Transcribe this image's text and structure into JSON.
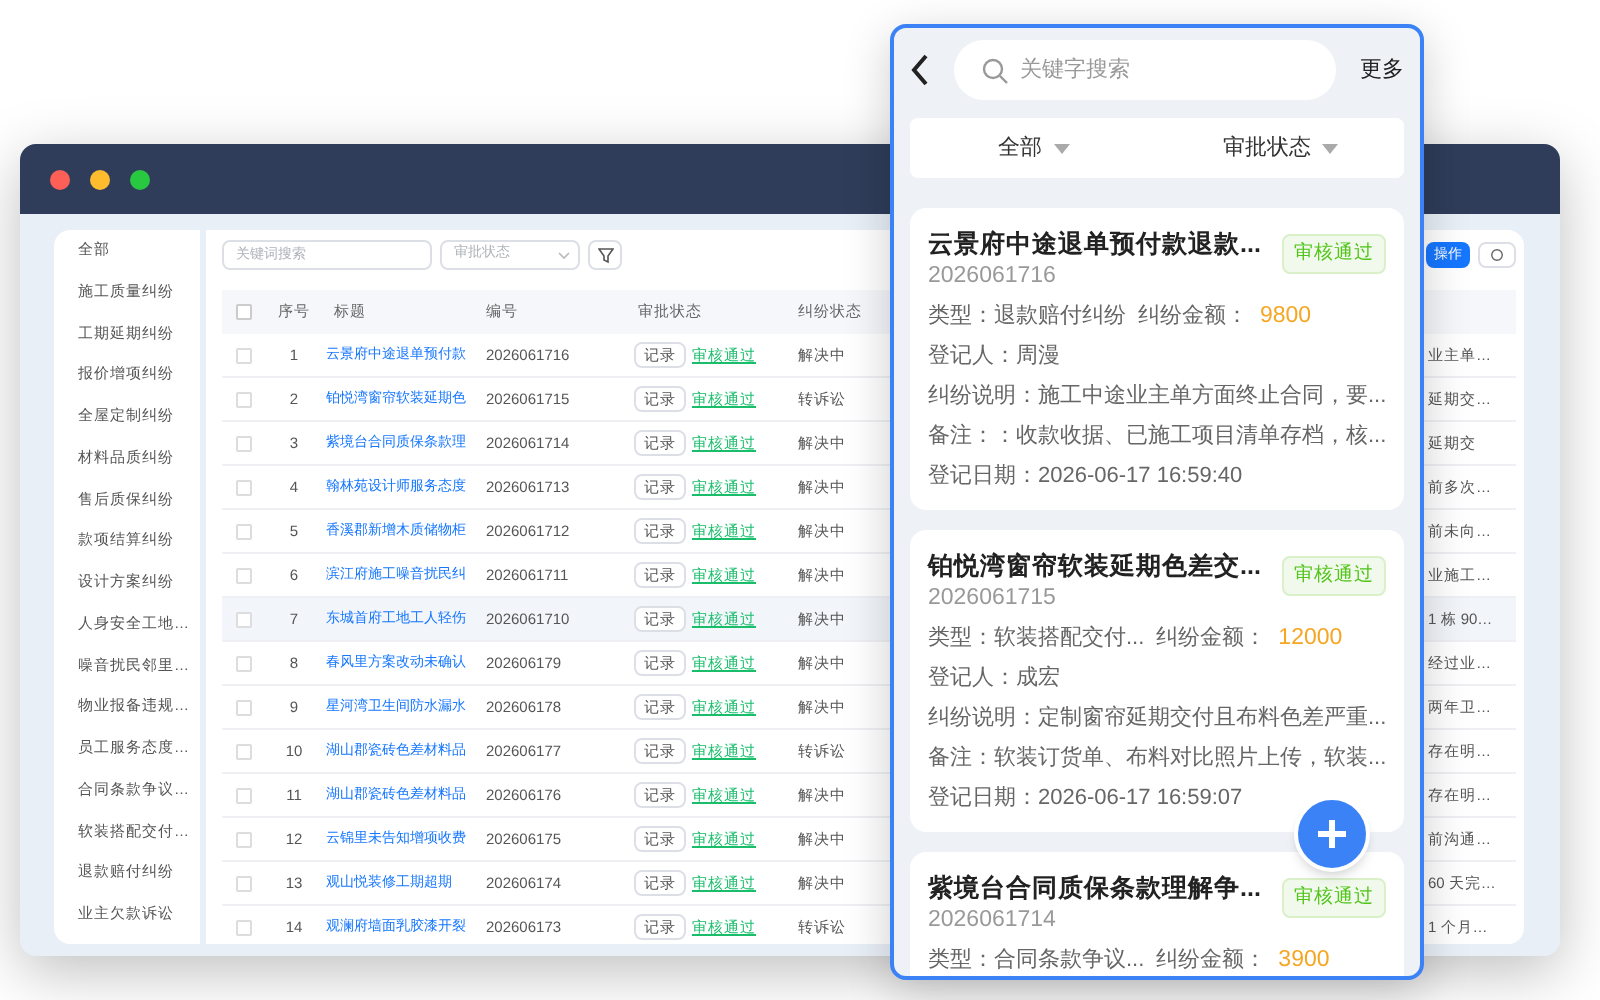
{
  "desktop_window": {
    "sidebar": {
      "items": [
        {
          "label": "全部"
        },
        {
          "label": "施工质量纠纷"
        },
        {
          "label": "工期延期纠纷"
        },
        {
          "label": "报价增项纠纷"
        },
        {
          "label": "全屋定制纠纷"
        },
        {
          "label": "材料品质纠纷"
        },
        {
          "label": "售后质保纠纷"
        },
        {
          "label": "款项结算纠纷"
        },
        {
          "label": "设计方案纠纷"
        },
        {
          "label": "人身安全工地…"
        },
        {
          "label": "噪音扰民邻里…"
        },
        {
          "label": "物业报备违规…"
        },
        {
          "label": "员工服务态度…"
        },
        {
          "label": "合同条款争议…"
        },
        {
          "label": "软装搭配交付…"
        },
        {
          "label": "退款赔付纠纷"
        },
        {
          "label": "业主欠款诉讼"
        }
      ]
    },
    "toolbar": {
      "search": {
        "placeholder": "关键词搜索"
      },
      "status_select": {
        "placeholder": "审批状态"
      },
      "action_button": "操作"
    },
    "table": {
      "header_checked": false,
      "columns": [
        "序号",
        "标题",
        "编号",
        "审批状态",
        "纠纷状态"
      ],
      "rows": [
        {
          "index": "1",
          "title": "云景府中途退单预付款",
          "number": "2026061716",
          "record_button": "记录",
          "approval": "审核通过",
          "dispute_status": "解决中",
          "column_7": "业主单…",
          "selected": false,
          "checked": false
        },
        {
          "index": "2",
          "title": "铂悦湾窗帘软装延期色",
          "number": "2026061715",
          "record_button": "记录",
          "approval": "审核通过",
          "dispute_status": "转诉讼",
          "column_7": "延期交…",
          "selected": false,
          "checked": false
        },
        {
          "index": "3",
          "title": "紫境台合同质保条款理",
          "number": "2026061714",
          "record_button": "记录",
          "approval": "审核通过",
          "dispute_status": "解决中",
          "column_7": "延期交",
          "selected": false,
          "checked": false
        },
        {
          "index": "4",
          "title": "翰林苑设计师服务态度",
          "number": "2026061713",
          "record_button": "记录",
          "approval": "审核通过",
          "dispute_status": "解决中",
          "column_7": "前多次…",
          "selected": false,
          "checked": false
        },
        {
          "index": "5",
          "title": "香溪郡新增木质储物柜",
          "number": "2026061712",
          "record_button": "记录",
          "approval": "审核通过",
          "dispute_status": "解决中",
          "column_7": "前未向…",
          "selected": false,
          "checked": false
        },
        {
          "index": "6",
          "title": "滨江府施工噪音扰民纠",
          "number": "2026061711",
          "record_button": "记录",
          "approval": "审核通过",
          "dispute_status": "解决中",
          "column_7": "业施工…",
          "selected": false,
          "checked": false
        },
        {
          "index": "7",
          "title": "东城首府工地工人轻伤",
          "number": "2026061710",
          "record_button": "记录",
          "approval": "审核通过",
          "dispute_status": "解决中",
          "column_7": "1 栋 90…",
          "selected": true,
          "checked": false
        },
        {
          "index": "8",
          "title": "春风里方案改动未确认",
          "number": "202606179",
          "record_button": "记录",
          "approval": "审核通过",
          "dispute_status": "解决中",
          "column_7": "经过业…",
          "selected": false,
          "checked": false
        },
        {
          "index": "9",
          "title": "星河湾卫生间防水漏水",
          "number": "202606178",
          "record_button": "记录",
          "approval": "审核通过",
          "dispute_status": "解决中",
          "column_7": "两年卫…",
          "selected": false,
          "checked": false
        },
        {
          "index": "10",
          "title": "湖山郡瓷砖色差材料品",
          "number": "202606177",
          "record_button": "记录",
          "approval": "审核通过",
          "dispute_status": "转诉讼",
          "column_7": "存在明…",
          "selected": false,
          "checked": false
        },
        {
          "index": "11",
          "title": "湖山郡瓷砖色差材料品",
          "number": "202606176",
          "record_button": "记录",
          "approval": "审核通过",
          "dispute_status": "解决中",
          "column_7": "存在明…",
          "selected": false,
          "checked": false
        },
        {
          "index": "12",
          "title": "云锦里未告知增项收费",
          "number": "202606175",
          "record_button": "记录",
          "approval": "审核通过",
          "dispute_status": "解决中",
          "column_7": "前沟通…",
          "selected": false,
          "checked": false
        },
        {
          "index": "13",
          "title": "观山悦装修工期超期",
          "number": "202606174",
          "record_button": "记录",
          "approval": "审核通过",
          "dispute_status": "解决中",
          "column_7": "60 天完…",
          "selected": false,
          "checked": false
        },
        {
          "index": "14",
          "title": "观澜府墙面乳胶漆开裂",
          "number": "202606173",
          "record_button": "记录",
          "approval": "审核通过",
          "dispute_status": "转诉讼",
          "column_7": "1 个月…",
          "selected": false,
          "checked": false
        }
      ]
    }
  },
  "mobile": {
    "search": {
      "placeholder": "关键字搜索"
    },
    "more": "更多",
    "filters": [
      "全部",
      "审批状态"
    ],
    "cards": [
      {
        "title": "云景府中途退单预付款退款...",
        "tag": "审核通过",
        "number": "2026061716",
        "type": "类型：退款赔付纠纷",
        "amount_label": "纠纷金额：",
        "amount": "9800",
        "registrant": "登记人：周漫",
        "description": "纠纷说明：施工中途业主单方面终止合同，要...",
        "notes": "备注：：收款收据、已施工项目清单存档，核...",
        "date": "登记日期：2026-06-17 16:59:40"
      },
      {
        "title": "铂悦湾窗帘软装延期色差交...",
        "tag": "审核通过",
        "number": "2026061715",
        "type": "类型：软装搭配交付...",
        "amount_label": "纠纷金额：",
        "amount": "12000",
        "registrant": "登记人：成宏",
        "description": "纠纷说明：定制窗帘延期交付且布料色差严重...",
        "notes": "备注：软装订货单、布料对比照片上传，软装...",
        "date": "登记日期：2026-06-17 16:59:07"
      },
      {
        "title": "紫境台合同质保条款理解争...",
        "tag": "审核通过",
        "number": "2026061714",
        "type": "类型：合同条款争议...",
        "amount_label": "纠纷金额：",
        "amount": "3900"
      }
    ]
  }
}
